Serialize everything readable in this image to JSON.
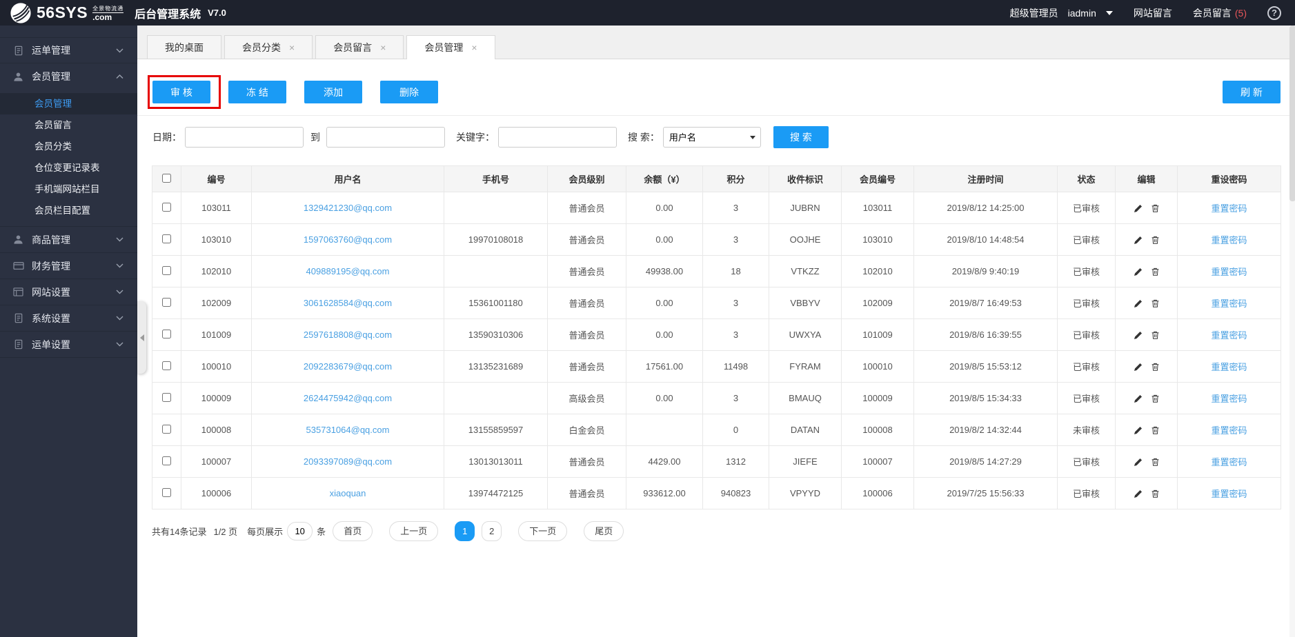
{
  "header": {
    "logo_text": "56SYS",
    "logo_tagline": "全景物流通",
    "logo_domain": ".com",
    "app_title": "后台管理系统",
    "version": "V7.0",
    "role": "超级管理员",
    "username": "iadmin",
    "nav_site_messages": "网站留言",
    "nav_member_messages": "会员留言",
    "member_messages_count": "(5)",
    "help": "?"
  },
  "sidebar": {
    "items": [
      {
        "label": "运单管理",
        "icon": "waybill-icon"
      },
      {
        "label": "会员管理",
        "icon": "member-icon"
      },
      {
        "label": "商品管理",
        "icon": "product-icon"
      },
      {
        "label": "财务管理",
        "icon": "finance-icon"
      },
      {
        "label": "网站设置",
        "icon": "website-icon"
      },
      {
        "label": "系统设置",
        "icon": "system-icon"
      },
      {
        "label": "运单设置",
        "icon": "waybill-settings-icon"
      }
    ],
    "submenu": [
      {
        "label": "会员管理",
        "active": true
      },
      {
        "label": "会员留言"
      },
      {
        "label": "会员分类"
      },
      {
        "label": "仓位变更记录表"
      },
      {
        "label": "手机端网站栏目"
      },
      {
        "label": "会员栏目配置"
      }
    ]
  },
  "tabs": [
    {
      "label": "我的桌面"
    },
    {
      "label": "会员分类",
      "close": "×"
    },
    {
      "label": "会员留言",
      "close": "×"
    },
    {
      "label": "会员管理",
      "close": "×",
      "active": true
    }
  ],
  "toolbar": {
    "audit": "审 核",
    "freeze": "冻 结",
    "add": "添加",
    "remove": "删除",
    "refresh": "刷 新"
  },
  "search": {
    "date_label": "日期：",
    "to_label": "到",
    "keyword_label": "关键字：",
    "by_label": "搜 索：",
    "by_value": "用户名",
    "button": "搜 索"
  },
  "table": {
    "headers": [
      "编号",
      "用户名",
      "手机号",
      "会员级别",
      "余额（¥）",
      "积分",
      "收件标识",
      "会员编号",
      "注册时间",
      "状态",
      "编辑",
      "重设密码"
    ],
    "reset_link": "重置密码",
    "rows": [
      {
        "id": "103011",
        "username": "1329421230@qq.com",
        "phone": "",
        "level": "普通会员",
        "balance": "0.00",
        "points": "3",
        "code": "JUBRN",
        "member_no": "103011",
        "registered": "2019/8/12 14:25:00",
        "status": "已审核"
      },
      {
        "id": "103010",
        "username": "1597063760@qq.com",
        "phone": "19970108018",
        "level": "普通会员",
        "balance": "0.00",
        "points": "3",
        "code": "OOJHE",
        "member_no": "103010",
        "registered": "2019/8/10 14:48:54",
        "status": "已审核"
      },
      {
        "id": "102010",
        "username": "409889195@qq.com",
        "phone": "",
        "level": "普通会员",
        "balance": "49938.00",
        "points": "18",
        "code": "VTKZZ",
        "member_no": "102010",
        "registered": "2019/8/9 9:40:19",
        "status": "已审核"
      },
      {
        "id": "102009",
        "username": "3061628584@qq.com",
        "phone": "15361001180",
        "level": "普通会员",
        "balance": "0.00",
        "points": "3",
        "code": "VBBYV",
        "member_no": "102009",
        "registered": "2019/8/7 16:49:53",
        "status": "已审核"
      },
      {
        "id": "101009",
        "username": "2597618808@qq.com",
        "phone": "13590310306",
        "level": "普通会员",
        "balance": "0.00",
        "points": "3",
        "code": "UWXYA",
        "member_no": "101009",
        "registered": "2019/8/6 16:39:55",
        "status": "已审核"
      },
      {
        "id": "100010",
        "username": "2092283679@qq.com",
        "phone": "13135231689",
        "level": "普通会员",
        "balance": "17561.00",
        "points": "11498",
        "code": "FYRAM",
        "member_no": "100010",
        "registered": "2019/8/5 15:53:12",
        "status": "已审核"
      },
      {
        "id": "100009",
        "username": "2624475942@qq.com",
        "phone": "",
        "level": "高级会员",
        "balance": "0.00",
        "points": "3",
        "code": "BMAUQ",
        "member_no": "100009",
        "registered": "2019/8/5 15:34:33",
        "status": "已审核"
      },
      {
        "id": "100008",
        "username": "535731064@qq.com",
        "phone": "13155859597",
        "level": "白金会员",
        "balance": "",
        "points": "0",
        "code": "DATAN",
        "member_no": "100008",
        "registered": "2019/8/2 14:32:44",
        "status": "未审核"
      },
      {
        "id": "100007",
        "username": "2093397089@qq.com",
        "phone": "13013013011",
        "level": "普通会员",
        "balance": "4429.00",
        "points": "1312",
        "code": "JIEFE",
        "member_no": "100007",
        "registered": "2019/8/5 14:27:29",
        "status": "已审核"
      },
      {
        "id": "100006",
        "username": "xiaoquan",
        "phone": "13974472125",
        "level": "普通会员",
        "balance": "933612.00",
        "points": "940823",
        "code": "VPYYD",
        "member_no": "100006",
        "registered": "2019/7/25 15:56:33",
        "status": "已审核"
      }
    ]
  },
  "pagination": {
    "total": "共有14条记录",
    "page": "1/2 页",
    "per_page_label": "每页展示",
    "per_page_value": "10",
    "per_page_unit": "条",
    "first": "首页",
    "prev": "上一页",
    "pages": [
      "1",
      "2"
    ],
    "active_page": "1",
    "next": "下一页",
    "last": "尾页"
  },
  "colors": {
    "accent_blue": "#1a9bf5",
    "link_blue": "#4aa0e2",
    "header_bg": "#1e222d",
    "sidebar_bg": "#2b3141",
    "badge_red": "#e9575a",
    "annotation_red": "#e60000"
  }
}
